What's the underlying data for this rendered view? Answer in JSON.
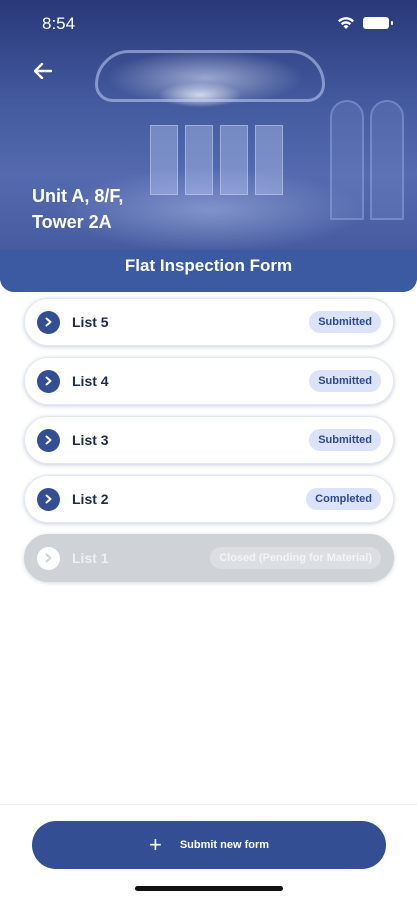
{
  "status_bar": {
    "time": "8:54"
  },
  "header": {
    "unit_title": "Unit A, 8/F,\nTower 2A",
    "form_title": "Flat Inspection Form"
  },
  "lists": [
    {
      "label": "List 5",
      "status": "Submitted"
    },
    {
      "label": "List 4",
      "status": "Submitted"
    },
    {
      "label": "List 3",
      "status": "Submitted"
    },
    {
      "label": "List 2",
      "status": "Completed"
    },
    {
      "label": "List 1",
      "status": "Closed (Pending for Material)"
    }
  ],
  "footer": {
    "submit_label": "Submit new form"
  },
  "colors": {
    "primary": "#334e93",
    "badge_bg": "#dbe3fa",
    "disabled": "#cfd2d6"
  },
  "icons": {
    "back": "arrow-left-icon",
    "chevron": "chevron-right-icon",
    "add": "plus-icon"
  }
}
